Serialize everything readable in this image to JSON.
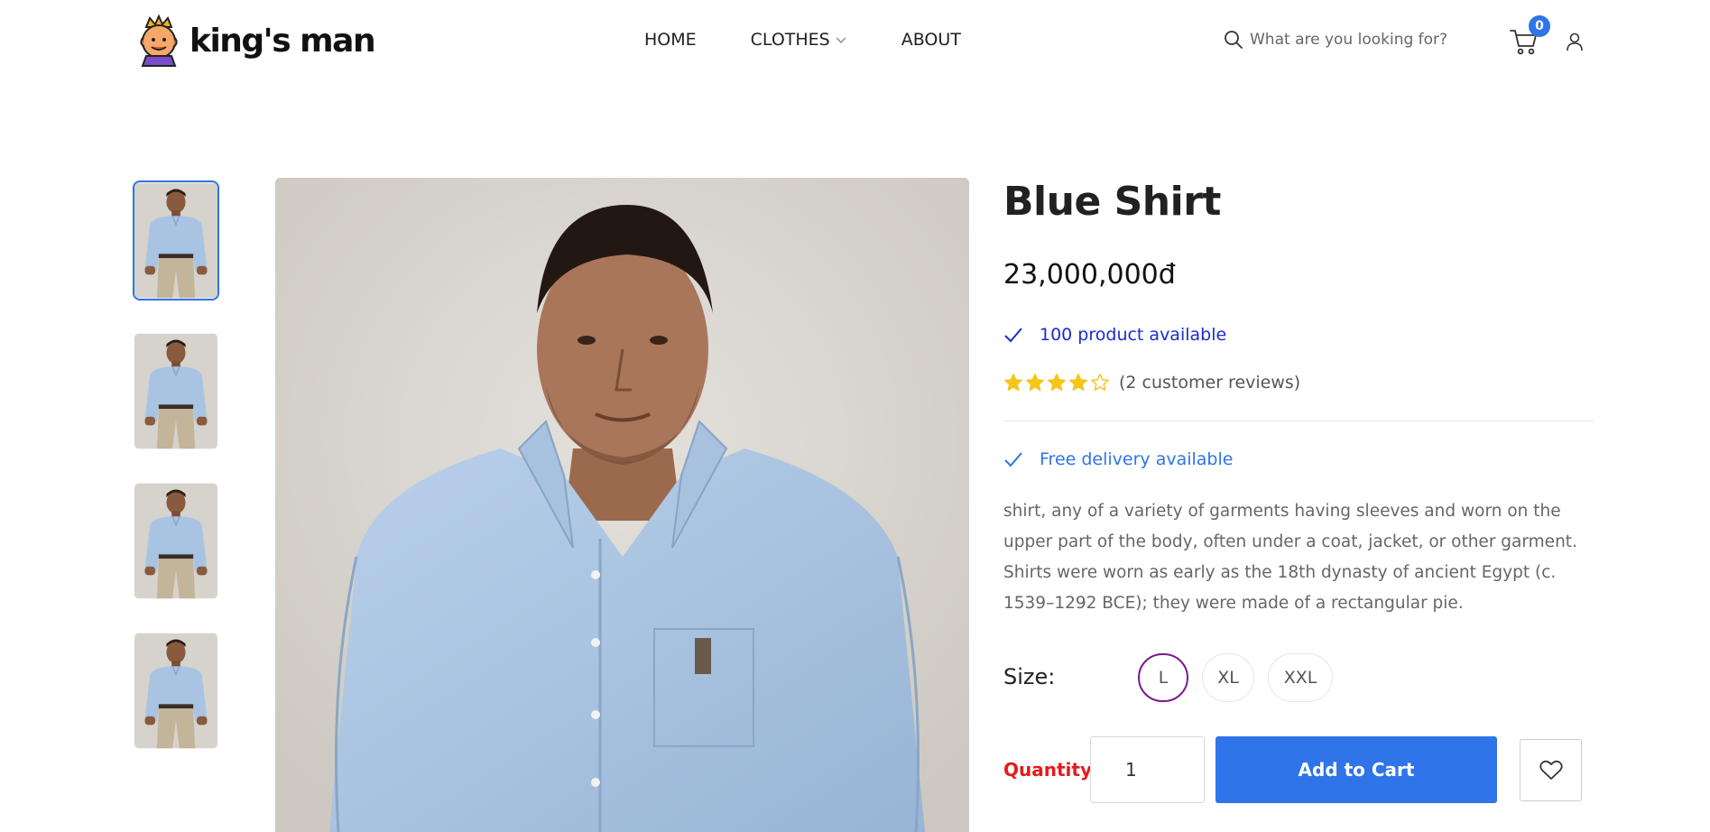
{
  "header": {
    "logo_text": "king's man",
    "nav": [
      {
        "label": "HOME"
      },
      {
        "label": "CLOTHES",
        "has_dropdown": true
      },
      {
        "label": "ABOUT"
      }
    ],
    "search": {
      "placeholder": "What are you looking for?",
      "icon": "search-icon"
    },
    "cart": {
      "count": "0",
      "icon": "cart-icon"
    },
    "user": {
      "icon": "user-icon"
    }
  },
  "gallery": {
    "thumbnails": [
      {
        "alt": "Blue Shirt view 1",
        "active": true
      },
      {
        "alt": "Blue Shirt view 2",
        "active": false
      },
      {
        "alt": "Blue Shirt view 3",
        "active": false
      },
      {
        "alt": "Blue Shirt view 4",
        "active": false
      }
    ],
    "main_image_alt": "Blue Shirt"
  },
  "product": {
    "title": "Blue Shirt",
    "price": "23,000,000đ",
    "stock_text": "100 product available",
    "rating": 4,
    "rating_max": 5,
    "reviews_text": "(2 customer reviews)",
    "delivery_text": "Free delivery available",
    "description": "shirt, any of a variety of garments having sleeves and worn on the upper part of the body, often under a coat, jacket, or other garment. Shirts were worn as early as the 18th dynasty of ancient Egypt (c. 1539–1292 BCE); they were made of a rectangular pie.",
    "size_label": "Size:",
    "sizes": [
      {
        "label": "L",
        "selected": true
      },
      {
        "label": "XL",
        "selected": false
      },
      {
        "label": "XXL",
        "selected": false
      }
    ],
    "quantity_label": "Quantity:",
    "quantity_value": "1",
    "add_to_cart_label": "Add to Cart",
    "wishlist_icon": "heart-icon"
  },
  "colors": {
    "accent": "#2f74e8",
    "stock_text": "#1a2bd6",
    "quantity_label": "#e41c1c",
    "selected_size_border": "#7a1a8a",
    "star": "#f5c518"
  }
}
